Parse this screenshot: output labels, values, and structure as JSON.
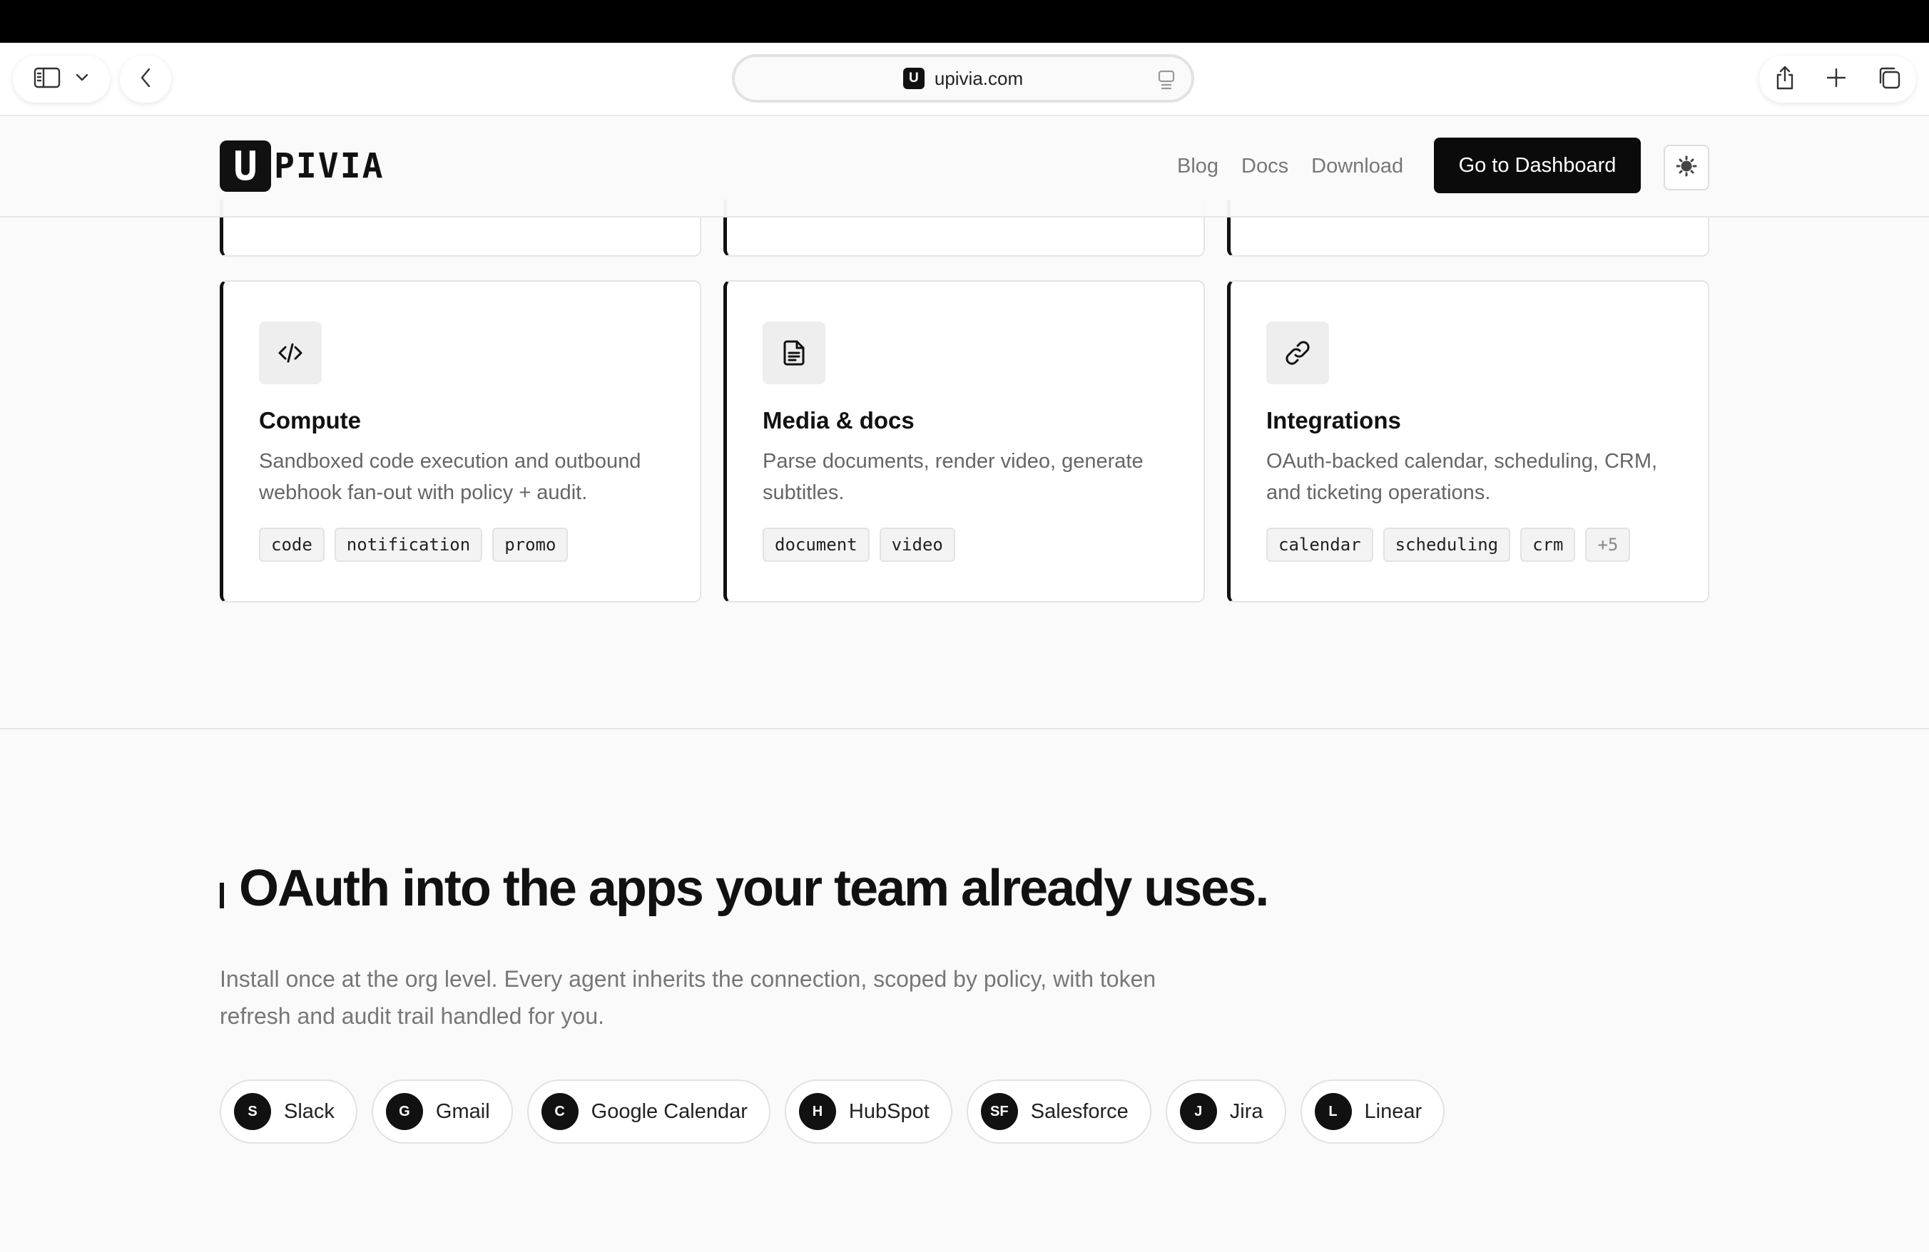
{
  "browser": {
    "url": "upivia.com",
    "favicon_letter": "U"
  },
  "site": {
    "logo_letter": "U",
    "logo_text": "PIVIA",
    "nav": [
      "Blog",
      "Docs",
      "Download"
    ],
    "cta_label": "Go to Dashboard"
  },
  "cards": [
    {
      "icon": "code-icon",
      "title": "Compute",
      "description": "Sandboxed code execution and outbound webhook fan-out with policy + audit.",
      "tags": [
        "code",
        "notification",
        "promo"
      ]
    },
    {
      "icon": "document-icon",
      "title": "Media & docs",
      "description": "Parse documents, render video, generate subtitles.",
      "tags": [
        "document",
        "video"
      ]
    },
    {
      "icon": "link-icon",
      "title": "Integrations",
      "description": "OAuth-backed calendar, scheduling, CRM, and ticketing operations.",
      "tags": [
        "calendar",
        "scheduling",
        "crm",
        "+5"
      ]
    }
  ],
  "section": {
    "heading": "OAuth into the apps your team already uses.",
    "subtext": "Install once at the org level. Every agent inherits the connection, scoped by policy, with token refresh and audit trail handled for you."
  },
  "apps": [
    {
      "badge": "S",
      "name": "Slack"
    },
    {
      "badge": "G",
      "name": "Gmail"
    },
    {
      "badge": "C",
      "name": "Google Calendar"
    },
    {
      "badge": "H",
      "name": "HubSpot"
    },
    {
      "badge": "SF",
      "name": "Salesforce"
    },
    {
      "badge": "J",
      "name": "Jira"
    },
    {
      "badge": "L",
      "name": "Linear"
    }
  ],
  "colors": {
    "accent": "#111111",
    "background": "#fafafa",
    "muted_text": "#666666"
  }
}
